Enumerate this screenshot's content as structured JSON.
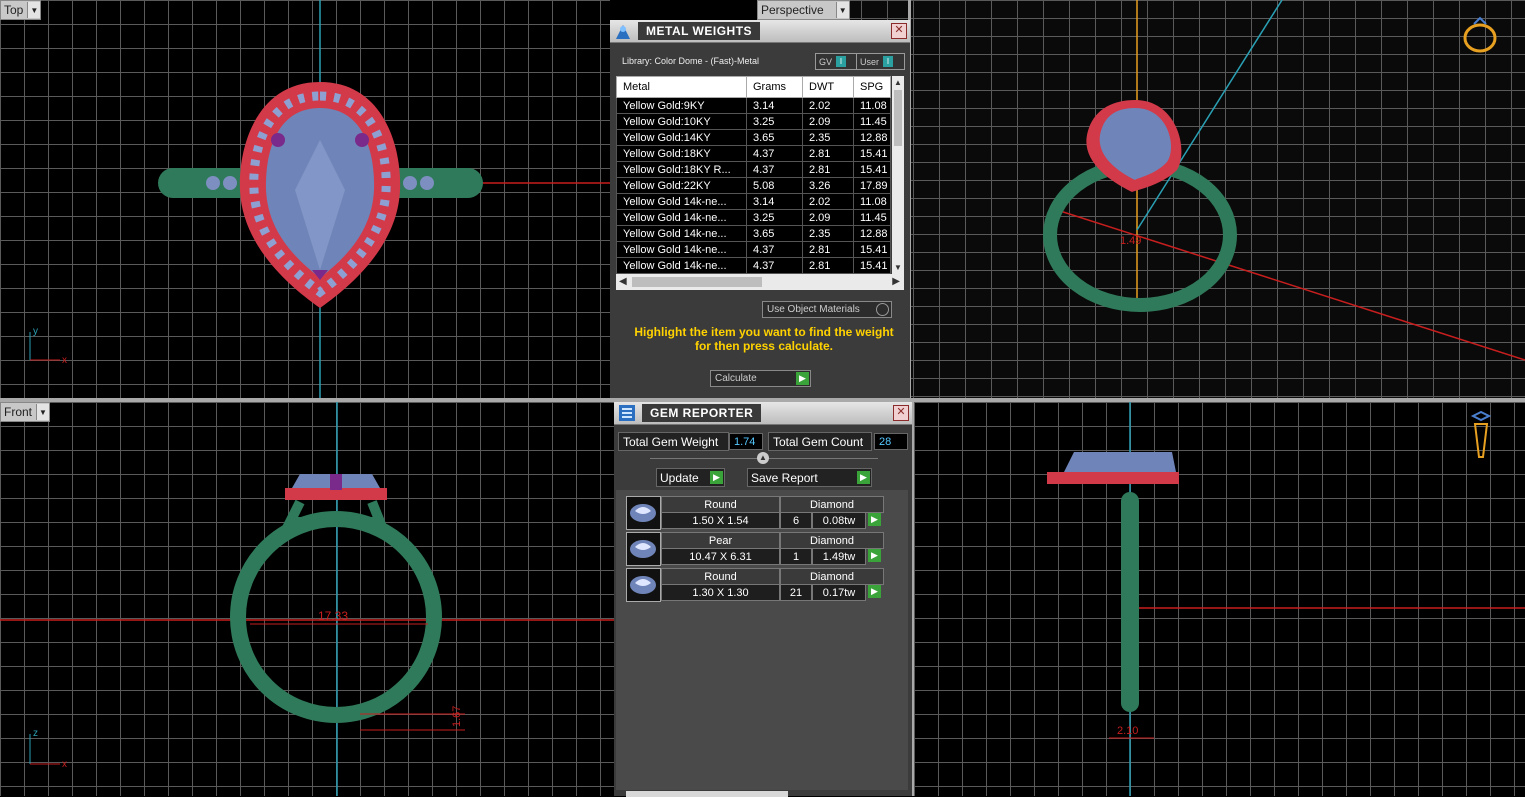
{
  "viewports": {
    "top": {
      "label": "Top",
      "axis_a": "y",
      "axis_b": "x"
    },
    "perspective": {
      "label": "Perspective"
    },
    "front": {
      "label": "Front",
      "axis_a": "z",
      "axis_b": "x",
      "dim_width": "17.33",
      "dim_band": "1.67"
    },
    "right": {
      "dim_width": "2.10"
    }
  },
  "metal_weights": {
    "title": "METAL WEIGHTS",
    "library": "Library: Color Dome - (Fast)-Metal",
    "gv_label": "GV",
    "user_label": "User",
    "columns": [
      "Metal",
      "Grams",
      "DWT",
      "SPG"
    ],
    "rows": [
      [
        "Yellow Gold:9KY",
        "3.14",
        "2.02",
        "11.08"
      ],
      [
        "Yellow Gold:10KY",
        "3.25",
        "2.09",
        "11.45"
      ],
      [
        "Yellow Gold:14KY",
        "3.65",
        "2.35",
        "12.88"
      ],
      [
        "Yellow Gold:18KY",
        "4.37",
        "2.81",
        "15.41"
      ],
      [
        "Yellow Gold:18KY R...",
        "4.37",
        "2.81",
        "15.41"
      ],
      [
        "Yellow Gold:22KY",
        "5.08",
        "3.26",
        "17.89"
      ],
      [
        "Yellow Gold 14k-ne...",
        "3.14",
        "2.02",
        "11.08"
      ],
      [
        "Yellow Gold 14k-ne...",
        "3.25",
        "2.09",
        "11.45"
      ],
      [
        "Yellow Gold 14k-ne...",
        "3.65",
        "2.35",
        "12.88"
      ],
      [
        "Yellow Gold 14k-ne...",
        "4.37",
        "2.81",
        "15.41"
      ],
      [
        "Yellow Gold 14k-ne...",
        "4.37",
        "2.81",
        "15.41"
      ]
    ],
    "use_object_materials": "Use Object Materials",
    "hint_line1": "Highlight the item you want to find the weight",
    "hint_line2": "for then press calculate.",
    "calculate": "Calculate"
  },
  "gem_reporter": {
    "title": "GEM REPORTER",
    "total_weight_label": "Total Gem Weight",
    "total_weight": "1.74",
    "total_count_label": "Total Gem Count",
    "total_count": "28",
    "update": "Update",
    "save_report": "Save Report",
    "gems": [
      {
        "shape": "Round",
        "material": "Diamond",
        "size": "1.50 X 1.54",
        "count": "6",
        "weight": "0.08tw"
      },
      {
        "shape": "Pear",
        "material": "Diamond",
        "size": "10.47 X 6.31",
        "count": "1",
        "weight": "1.49tw"
      },
      {
        "shape": "Round",
        "material": "Diamond",
        "size": "1.30 X 1.30",
        "count": "21",
        "weight": "0.17tw"
      }
    ]
  },
  "colors": {
    "band": "#2f7a5a",
    "halo": "#d23a4a",
    "gem": "#6f84b8",
    "accent_stone": "#7a2a8a",
    "axis_red": "#c81e1e",
    "axis_cyan": "#2aa0b4"
  }
}
